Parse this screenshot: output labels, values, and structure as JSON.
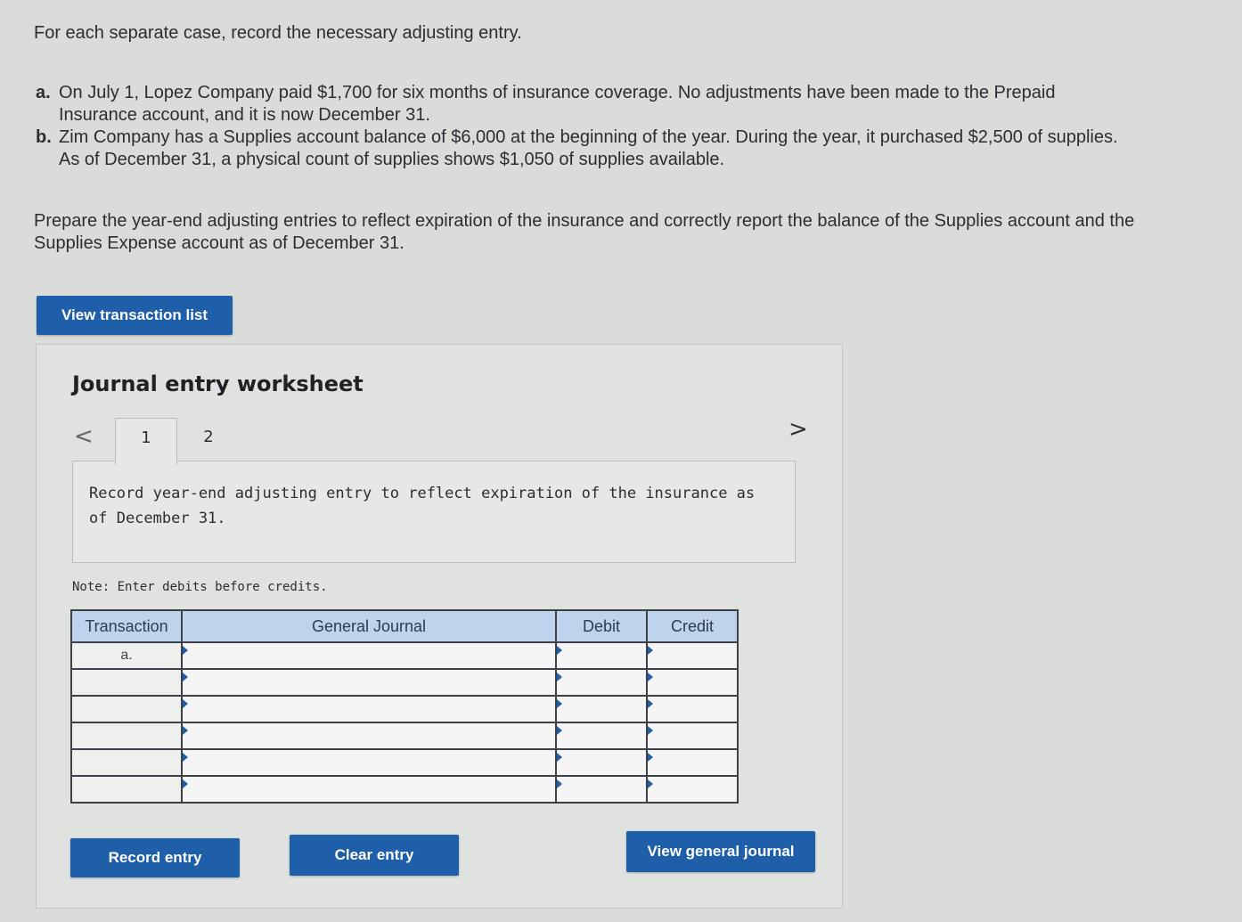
{
  "intro": "For each separate case, record the necessary adjusting entry.",
  "cases": [
    {
      "letter": "a.",
      "text": "On July 1, Lopez Company paid $1,700 for six months of insurance coverage. No adjustments have been made to the Prepaid Insurance account, and it is now December 31."
    },
    {
      "letter": "b.",
      "text": "Zim Company has a Supplies account balance of $6,000 at the beginning of the year. During the year, it purchased $2,500 of supplies. As of December 31, a physical count of supplies shows $1,050 of supplies available."
    }
  ],
  "prepare": "Prepare the year-end adjusting entries to reflect expiration of the insurance and correctly report the balance of the Supplies account and the Supplies Expense account as of December 31.",
  "buttons": {
    "view_transaction_list": "View transaction list",
    "record_entry": "Record entry",
    "clear_entry": "Clear entry",
    "view_general_journal": "View general journal"
  },
  "worksheet": {
    "title": "Journal entry worksheet",
    "nav_prev": "<",
    "nav_next": ">",
    "tabs": [
      "1",
      "2"
    ],
    "active_tab": "1",
    "instruction": "Record year-end adjusting entry to reflect expiration of the insurance as of December 31.",
    "note": "Note: Enter debits before credits.",
    "table": {
      "headers": {
        "transaction": "Transaction",
        "general_journal": "General Journal",
        "debit": "Debit",
        "credit": "Credit"
      },
      "rows": [
        {
          "transaction": "a.",
          "general_journal": "",
          "debit": "",
          "credit": ""
        },
        {
          "transaction": "",
          "general_journal": "",
          "debit": "",
          "credit": ""
        },
        {
          "transaction": "",
          "general_journal": "",
          "debit": "",
          "credit": ""
        },
        {
          "transaction": "",
          "general_journal": "",
          "debit": "",
          "credit": ""
        },
        {
          "transaction": "",
          "general_journal": "",
          "debit": "",
          "credit": ""
        },
        {
          "transaction": "",
          "general_journal": "",
          "debit": "",
          "credit": ""
        }
      ]
    }
  },
  "colors": {
    "button_blue": "#1f5ea8",
    "table_header": "#bfd3ec",
    "page_background": "#d9dcd8"
  }
}
